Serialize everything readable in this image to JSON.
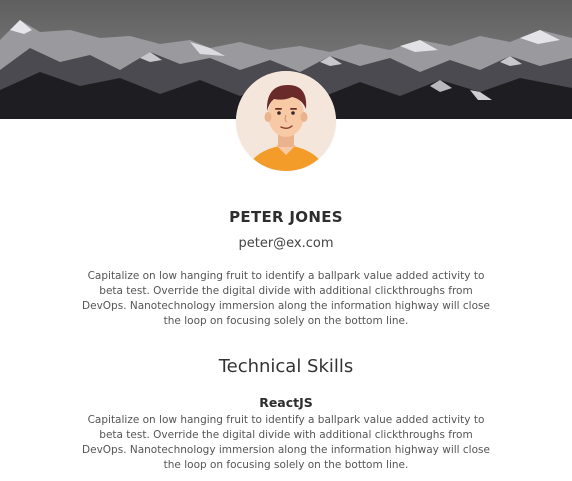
{
  "profile": {
    "name": "PETER JONES",
    "email": "peter@ex.com",
    "bio": "Capitalize on low hanging fruit to identify a ballpark value added activity to beta test. Override the digital divide with additional clickthroughs from DevOps. Nanotechnology immersion along the information highway will close the loop on focusing solely on the bottom line."
  },
  "skills": {
    "section_title": "Technical Skills",
    "items": [
      {
        "name": "ReactJS",
        "description": "Capitalize on low hanging fruit to identify a ballpark value added activity to beta test. Override the digital divide with additional clickthroughs from DevOps. Nanotechnology immersion along the information highway will close the loop on focusing solely on the bottom line."
      }
    ]
  },
  "images": {
    "banner": "mountain-landscape-photo",
    "avatar": "man-avatar-illustration"
  },
  "colors": {
    "avatar_bg": "#f5e6dc",
    "shirt": "#f39c2a",
    "hair": "#6b2a2a",
    "skin": "#f7c9a4"
  }
}
